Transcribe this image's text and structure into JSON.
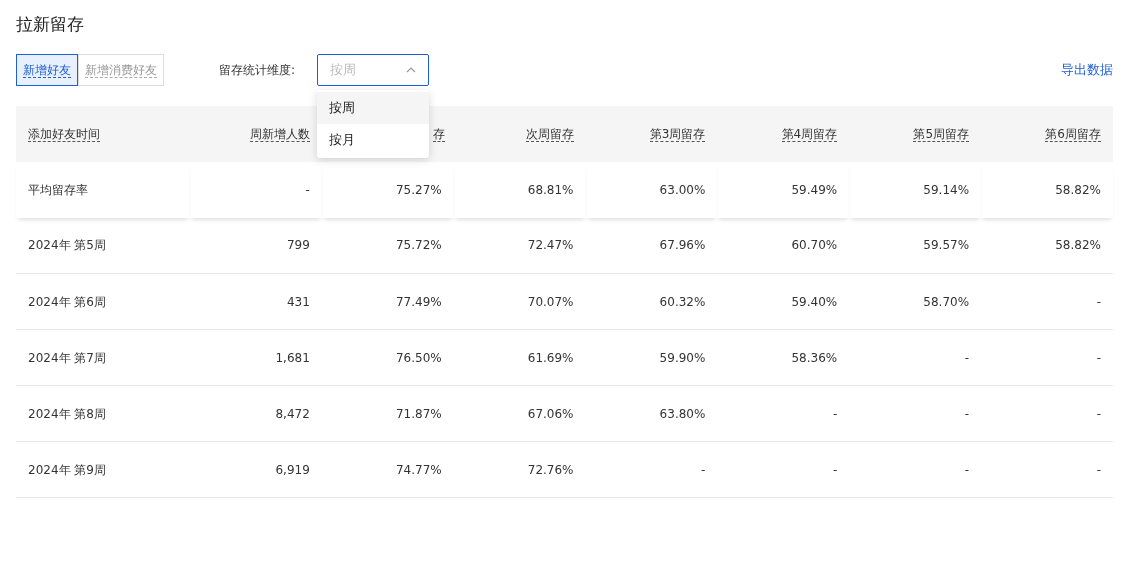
{
  "title": "拉新留存",
  "segments": [
    {
      "label": "新增好友",
      "selected": true
    },
    {
      "label": "新增消费好友",
      "selected": false
    }
  ],
  "filter": {
    "label": "留存统计维度:",
    "placeholder": "按周",
    "expanded": true,
    "options": [
      {
        "label": "按周",
        "selected": true
      },
      {
        "label": "按月",
        "selected": false
      }
    ]
  },
  "export_link": "导出数据",
  "table": {
    "columns": [
      "添加好友时间",
      "周新增人数",
      "存",
      "次周留存",
      "第3周留存",
      "第4周留存",
      "第5周留存",
      "第6周留存"
    ],
    "summary_row": [
      "平均留存率",
      "-",
      "75.27%",
      "68.81%",
      "63.00%",
      "59.49%",
      "59.14%",
      "58.82%"
    ],
    "rows": [
      [
        "2024年 第5周",
        "799",
        "75.72%",
        "72.47%",
        "67.96%",
        "60.70%",
        "59.57%",
        "58.82%"
      ],
      [
        "2024年 第6周",
        "431",
        "77.49%",
        "70.07%",
        "60.32%",
        "59.40%",
        "58.70%",
        "-"
      ],
      [
        "2024年 第7周",
        "1,681",
        "76.50%",
        "61.69%",
        "59.90%",
        "58.36%",
        "-",
        "-"
      ],
      [
        "2024年 第8周",
        "8,472",
        "71.87%",
        "67.06%",
        "63.80%",
        "-",
        "-",
        "-"
      ],
      [
        "2024年 第9周",
        "6,919",
        "74.77%",
        "72.76%",
        "-",
        "-",
        "-",
        "-"
      ]
    ]
  }
}
